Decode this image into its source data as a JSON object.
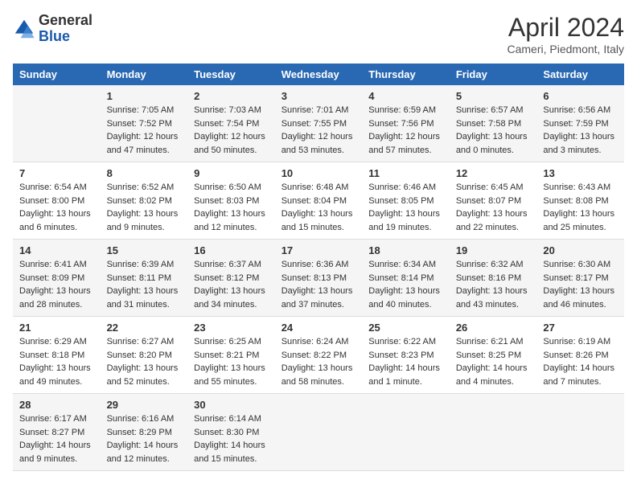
{
  "header": {
    "logo_general": "General",
    "logo_blue": "Blue",
    "month_title": "April 2024",
    "subtitle": "Cameri, Piedmont, Italy"
  },
  "columns": [
    "Sunday",
    "Monday",
    "Tuesday",
    "Wednesday",
    "Thursday",
    "Friday",
    "Saturday"
  ],
  "weeks": [
    [
      {
        "day": "",
        "info": ""
      },
      {
        "day": "1",
        "info": "Sunrise: 7:05 AM\nSunset: 7:52 PM\nDaylight: 12 hours\nand 47 minutes."
      },
      {
        "day": "2",
        "info": "Sunrise: 7:03 AM\nSunset: 7:54 PM\nDaylight: 12 hours\nand 50 minutes."
      },
      {
        "day": "3",
        "info": "Sunrise: 7:01 AM\nSunset: 7:55 PM\nDaylight: 12 hours\nand 53 minutes."
      },
      {
        "day": "4",
        "info": "Sunrise: 6:59 AM\nSunset: 7:56 PM\nDaylight: 12 hours\nand 57 minutes."
      },
      {
        "day": "5",
        "info": "Sunrise: 6:57 AM\nSunset: 7:58 PM\nDaylight: 13 hours\nand 0 minutes."
      },
      {
        "day": "6",
        "info": "Sunrise: 6:56 AM\nSunset: 7:59 PM\nDaylight: 13 hours\nand 3 minutes."
      }
    ],
    [
      {
        "day": "7",
        "info": "Sunrise: 6:54 AM\nSunset: 8:00 PM\nDaylight: 13 hours\nand 6 minutes."
      },
      {
        "day": "8",
        "info": "Sunrise: 6:52 AM\nSunset: 8:02 PM\nDaylight: 13 hours\nand 9 minutes."
      },
      {
        "day": "9",
        "info": "Sunrise: 6:50 AM\nSunset: 8:03 PM\nDaylight: 13 hours\nand 12 minutes."
      },
      {
        "day": "10",
        "info": "Sunrise: 6:48 AM\nSunset: 8:04 PM\nDaylight: 13 hours\nand 15 minutes."
      },
      {
        "day": "11",
        "info": "Sunrise: 6:46 AM\nSunset: 8:05 PM\nDaylight: 13 hours\nand 19 minutes."
      },
      {
        "day": "12",
        "info": "Sunrise: 6:45 AM\nSunset: 8:07 PM\nDaylight: 13 hours\nand 22 minutes."
      },
      {
        "day": "13",
        "info": "Sunrise: 6:43 AM\nSunset: 8:08 PM\nDaylight: 13 hours\nand 25 minutes."
      }
    ],
    [
      {
        "day": "14",
        "info": "Sunrise: 6:41 AM\nSunset: 8:09 PM\nDaylight: 13 hours\nand 28 minutes."
      },
      {
        "day": "15",
        "info": "Sunrise: 6:39 AM\nSunset: 8:11 PM\nDaylight: 13 hours\nand 31 minutes."
      },
      {
        "day": "16",
        "info": "Sunrise: 6:37 AM\nSunset: 8:12 PM\nDaylight: 13 hours\nand 34 minutes."
      },
      {
        "day": "17",
        "info": "Sunrise: 6:36 AM\nSunset: 8:13 PM\nDaylight: 13 hours\nand 37 minutes."
      },
      {
        "day": "18",
        "info": "Sunrise: 6:34 AM\nSunset: 8:14 PM\nDaylight: 13 hours\nand 40 minutes."
      },
      {
        "day": "19",
        "info": "Sunrise: 6:32 AM\nSunset: 8:16 PM\nDaylight: 13 hours\nand 43 minutes."
      },
      {
        "day": "20",
        "info": "Sunrise: 6:30 AM\nSunset: 8:17 PM\nDaylight: 13 hours\nand 46 minutes."
      }
    ],
    [
      {
        "day": "21",
        "info": "Sunrise: 6:29 AM\nSunset: 8:18 PM\nDaylight: 13 hours\nand 49 minutes."
      },
      {
        "day": "22",
        "info": "Sunrise: 6:27 AM\nSunset: 8:20 PM\nDaylight: 13 hours\nand 52 minutes."
      },
      {
        "day": "23",
        "info": "Sunrise: 6:25 AM\nSunset: 8:21 PM\nDaylight: 13 hours\nand 55 minutes."
      },
      {
        "day": "24",
        "info": "Sunrise: 6:24 AM\nSunset: 8:22 PM\nDaylight: 13 hours\nand 58 minutes."
      },
      {
        "day": "25",
        "info": "Sunrise: 6:22 AM\nSunset: 8:23 PM\nDaylight: 14 hours\nand 1 minute."
      },
      {
        "day": "26",
        "info": "Sunrise: 6:21 AM\nSunset: 8:25 PM\nDaylight: 14 hours\nand 4 minutes."
      },
      {
        "day": "27",
        "info": "Sunrise: 6:19 AM\nSunset: 8:26 PM\nDaylight: 14 hours\nand 7 minutes."
      }
    ],
    [
      {
        "day": "28",
        "info": "Sunrise: 6:17 AM\nSunset: 8:27 PM\nDaylight: 14 hours\nand 9 minutes."
      },
      {
        "day": "29",
        "info": "Sunrise: 6:16 AM\nSunset: 8:29 PM\nDaylight: 14 hours\nand 12 minutes."
      },
      {
        "day": "30",
        "info": "Sunrise: 6:14 AM\nSunset: 8:30 PM\nDaylight: 14 hours\nand 15 minutes."
      },
      {
        "day": "",
        "info": ""
      },
      {
        "day": "",
        "info": ""
      },
      {
        "day": "",
        "info": ""
      },
      {
        "day": "",
        "info": ""
      }
    ]
  ]
}
